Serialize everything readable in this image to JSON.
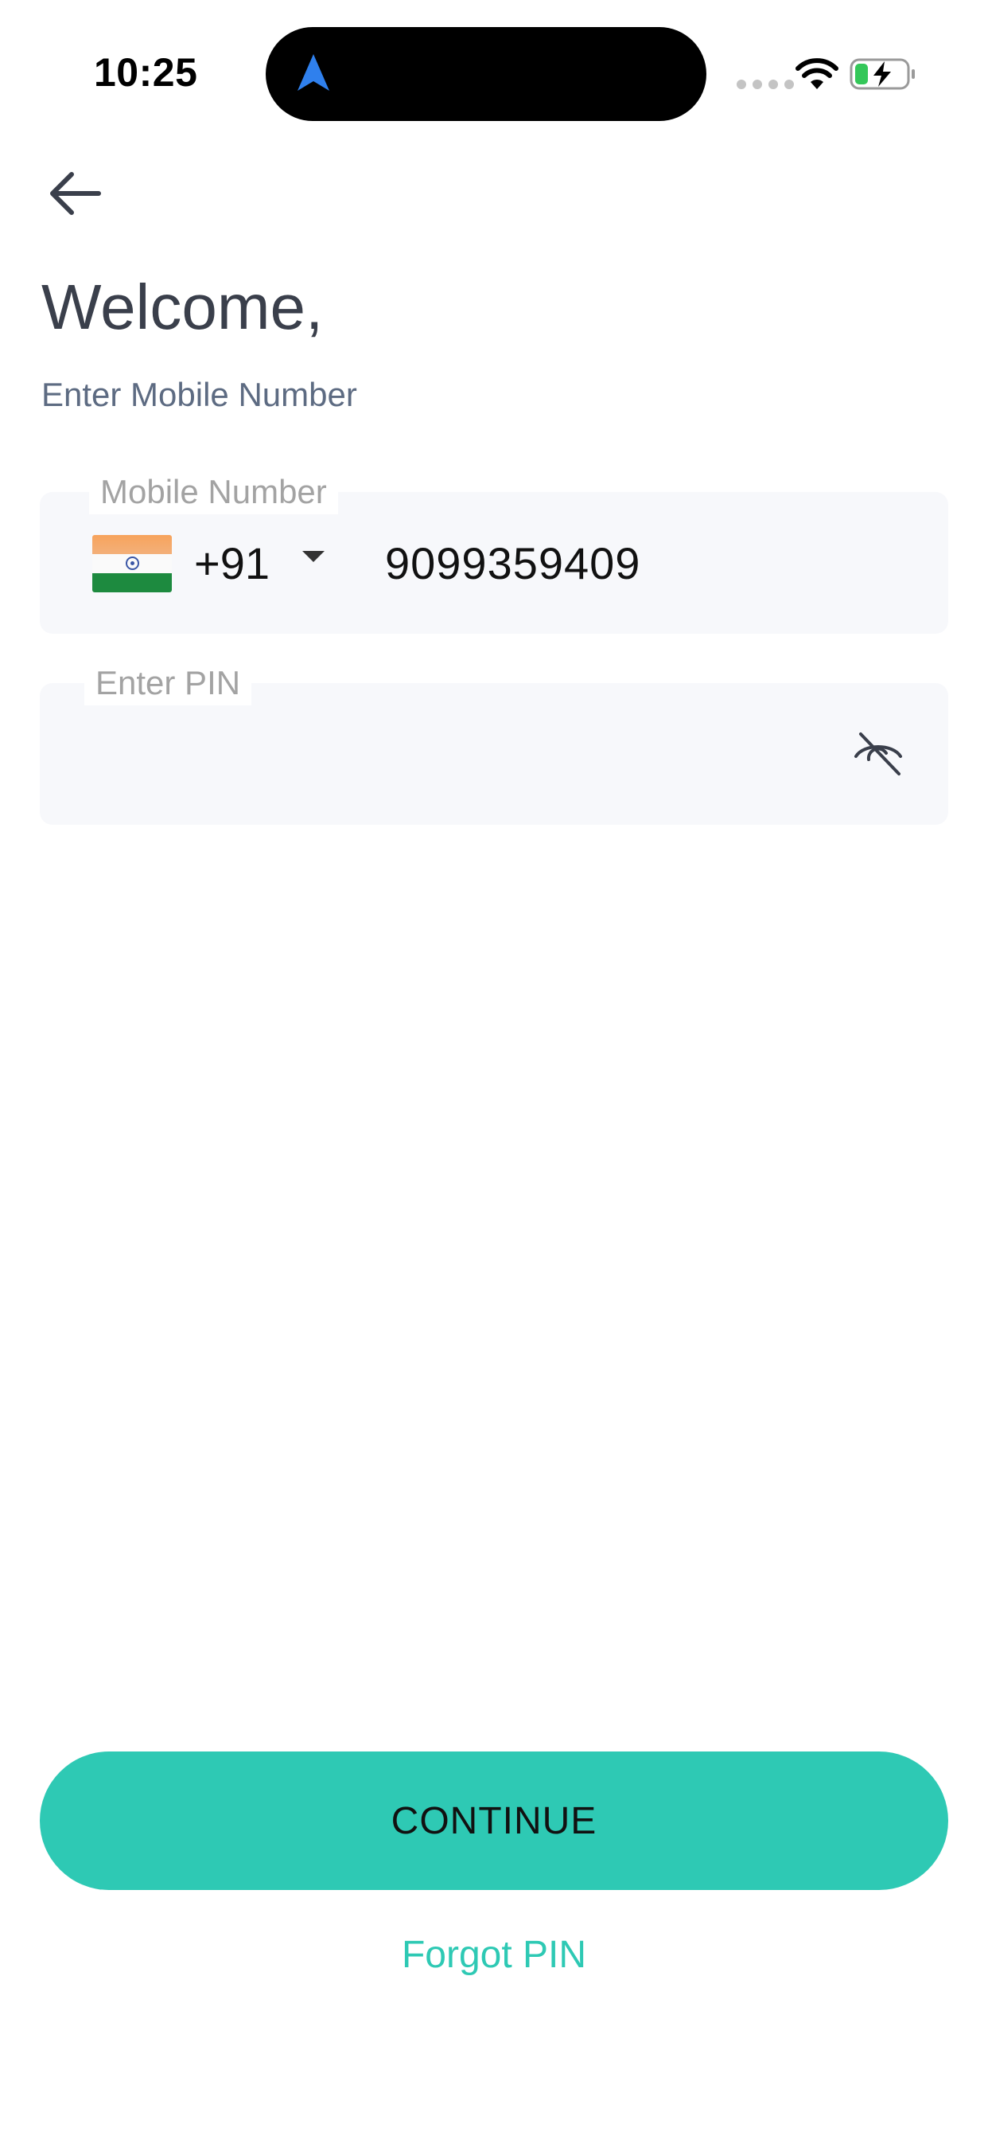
{
  "status_bar": {
    "time": "10:25"
  },
  "screen": {
    "title": "Welcome,",
    "subtitle": "Enter Mobile Number"
  },
  "mobile_field": {
    "label": "Mobile Number",
    "country_flag": "india-flag",
    "dial_code": "+91",
    "value": "9099359409"
  },
  "pin_field": {
    "label": "Enter PIN",
    "value": "",
    "visibility_icon": "eye-off-icon"
  },
  "actions": {
    "continue_label": "CONTINUE",
    "forgot_label": "Forgot PIN"
  },
  "colors": {
    "accent": "#2ec9b4",
    "title_text": "#3a3f4b",
    "subtitle_text": "#5d6b82",
    "field_bg": "#f7f8fb",
    "label_text": "#a3a3a3"
  }
}
